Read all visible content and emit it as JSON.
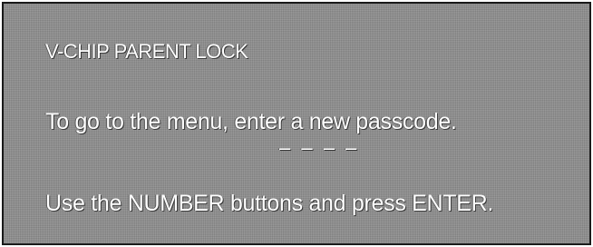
{
  "menu": {
    "title": "V-CHIP PARENT LOCK",
    "instruction": "To go to the menu, enter a new passcode.",
    "passcode_placeholder": "– – – –",
    "hint": "Use the NUMBER buttons and press ENTER."
  },
  "colors": {
    "background": "#8e8e8e",
    "text": "#ffffff",
    "border": "#1a1a1a"
  }
}
